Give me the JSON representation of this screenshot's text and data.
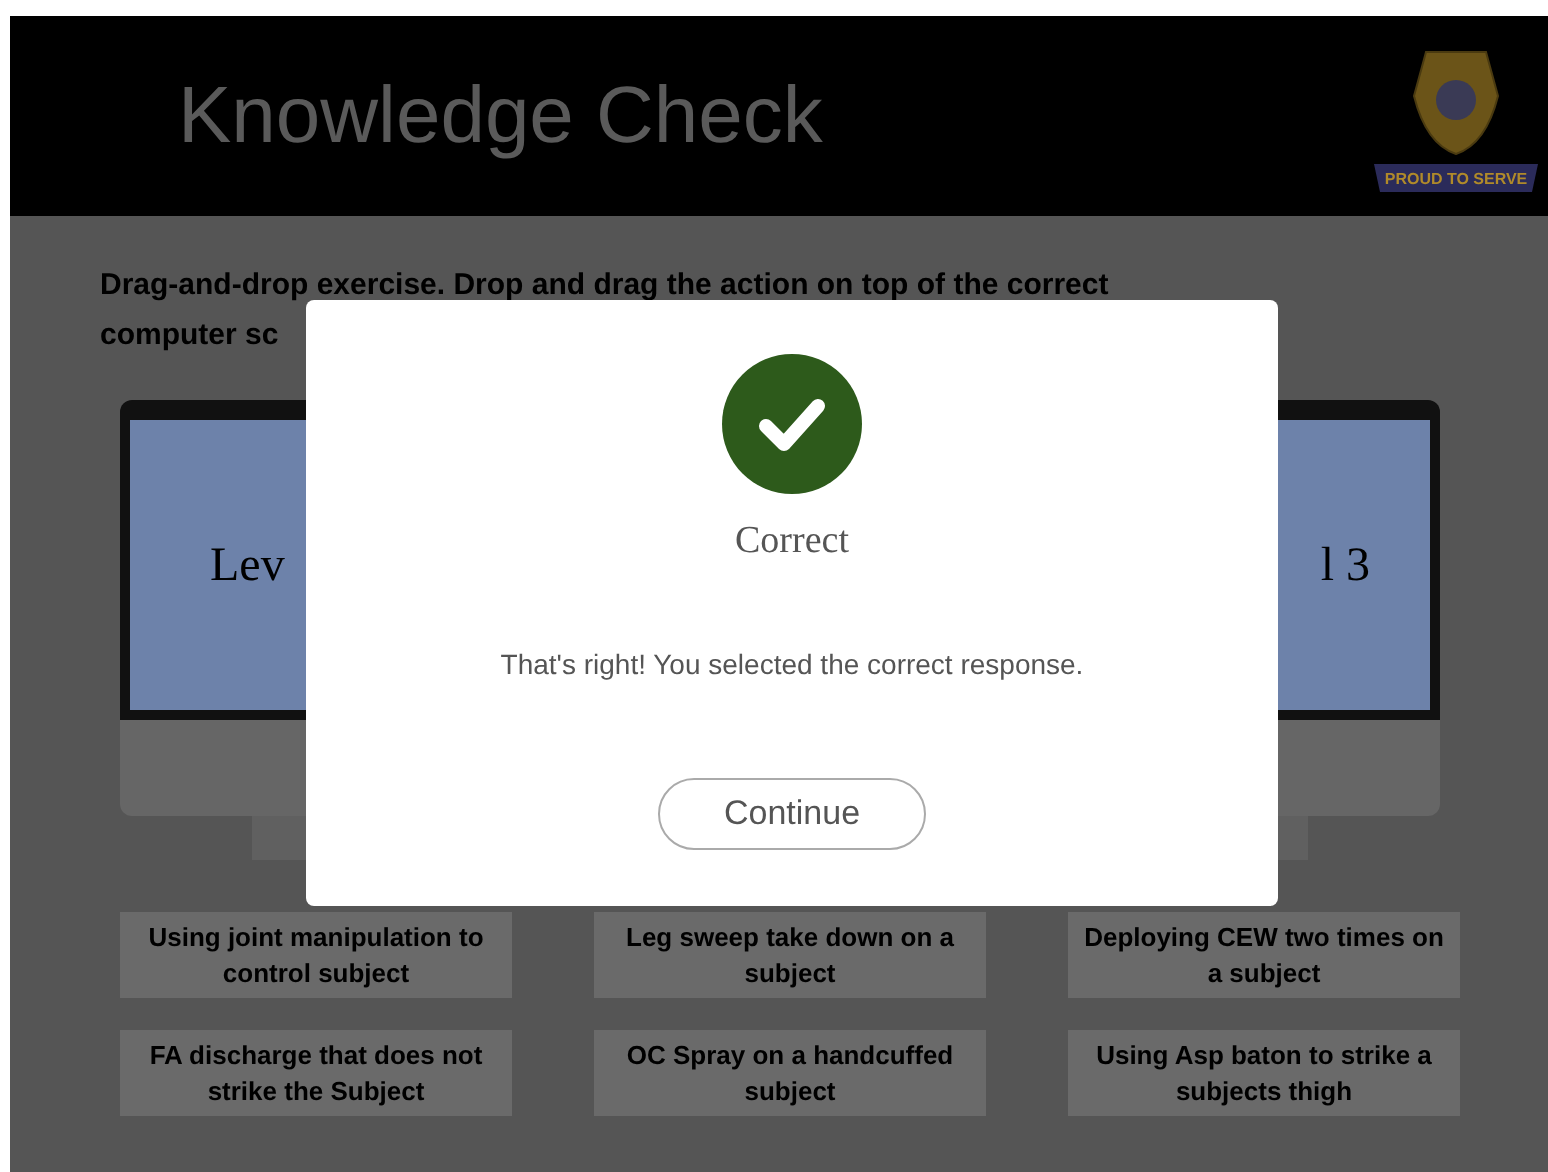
{
  "header": {
    "title": "Knowledge Check",
    "logo_banner": "PROUD TO SERVE"
  },
  "instructions": "Drag-and-drop exercise. Drop and drag the action on top of the correct computer sc",
  "monitor_labels": [
    "Lev",
    "l 3"
  ],
  "actions": [
    {
      "label": "Using joint manipulation to control subject"
    },
    {
      "label": "Leg sweep take down on a subject"
    },
    {
      "label": "Deploying CEW two times on a subject"
    },
    {
      "label": "FA discharge that does not strike the Subject"
    },
    {
      "label": "OC Spray on a handcuffed subject"
    },
    {
      "label": "Using Asp baton to strike a subjects thigh"
    }
  ],
  "dialog": {
    "title": "Correct",
    "message": "That's right!  You selected the correct response.",
    "button": "Continue"
  }
}
